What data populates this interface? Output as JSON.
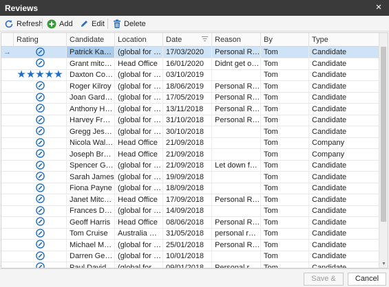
{
  "window": {
    "title": "Reviews",
    "close_glyph": "×"
  },
  "toolbar": {
    "refresh_label": "Refresh",
    "add_label": "Add",
    "edit_label": "Edit",
    "delete_label": "Delete"
  },
  "grid": {
    "columns": [
      "Rating",
      "Candidate",
      "Location",
      "Date",
      "Reason",
      "By",
      "Type"
    ],
    "rows": [
      {
        "rating": "icon",
        "candidate": "Patrick Kaufm...",
        "location": "(global for all l...",
        "date": "17/03/2020",
        "reason": "Personal Reas...",
        "by": "Tom",
        "type": "Candidate",
        "selected": true
      },
      {
        "rating": "icon",
        "candidate": "Grant mitchell",
        "location": "Head Office",
        "date": "16/01/2020",
        "reason": "Didnt get on...",
        "by": "Tom",
        "type": "Candidate"
      },
      {
        "rating": "stars",
        "stars": 5,
        "candidate": "Daxton Combs",
        "location": "(global for all l...",
        "date": "03/10/2019",
        "reason": "",
        "by": "Tom",
        "type": "Candidate"
      },
      {
        "rating": "icon",
        "candidate": "Roger Kilroy",
        "location": "(global for all l...",
        "date": "18/06/2019",
        "reason": "Personal Reas...",
        "by": "Tom",
        "type": "Candidate"
      },
      {
        "rating": "icon",
        "candidate": "Joan Gardner",
        "location": "(global for all l...",
        "date": "17/05/2019",
        "reason": "Personal Reas...",
        "by": "Tom",
        "type": "Candidate"
      },
      {
        "rating": "icon",
        "candidate": "Anthony Hutc...",
        "location": "(global for all l...",
        "date": "13/11/2018",
        "reason": "Personal Reas...",
        "by": "Tom",
        "type": "Candidate"
      },
      {
        "rating": "icon",
        "candidate": "Harvey Freem...",
        "location": "(global for all l...",
        "date": "31/10/2018",
        "reason": "Personal Reas...",
        "by": "Tom",
        "type": "Candidate"
      },
      {
        "rating": "icon",
        "candidate": "Gregg Jessop",
        "location": "(global for all l...",
        "date": "30/10/2018",
        "reason": "",
        "by": "Tom",
        "type": "Candidate"
      },
      {
        "rating": "icon",
        "candidate": "Nicola Walters",
        "location": "Head Office",
        "date": "21/09/2018",
        "reason": "",
        "by": "Tom",
        "type": "Company"
      },
      {
        "rating": "icon",
        "candidate": "Joseph Brown",
        "location": "Head Office",
        "date": "21/09/2018",
        "reason": "",
        "by": "Tom",
        "type": "Company"
      },
      {
        "rating": "icon",
        "candidate": "Spencer Grey",
        "location": "(global for all l...",
        "date": "21/09/2018",
        "reason": "Let down for...",
        "by": "Tom",
        "type": "Candidate"
      },
      {
        "rating": "icon",
        "candidate": "Sarah James",
        "location": "(global for all l...",
        "date": "19/09/2018",
        "reason": "",
        "by": "Tom",
        "type": "Candidate"
      },
      {
        "rating": "icon",
        "candidate": "Fiona Payne",
        "location": "(global for all l...",
        "date": "18/09/2018",
        "reason": "",
        "by": "Tom",
        "type": "Candidate"
      },
      {
        "rating": "icon",
        "candidate": "Janet Mitchell",
        "location": "Head Office",
        "date": "17/09/2018",
        "reason": "Personal Reas...",
        "by": "Tom",
        "type": "Candidate"
      },
      {
        "rating": "icon",
        "candidate": "Frances Drake",
        "location": "(global for all l...",
        "date": "14/09/2018",
        "reason": "",
        "by": "Tom",
        "type": "Candidate"
      },
      {
        "rating": "icon",
        "candidate": "Geoff Harris",
        "location": "Head Office",
        "date": "08/06/2018",
        "reason": "Personal Reas...",
        "by": "Tom",
        "type": "Candidate"
      },
      {
        "rating": "icon",
        "candidate": "Tom Cruise",
        "location": "Australia Office",
        "date": "31/05/2018",
        "reason": "personal reas...",
        "by": "Tom",
        "type": "Candidate"
      },
      {
        "rating": "icon",
        "candidate": "Michael Martins",
        "location": "(global for all l...",
        "date": "25/01/2018",
        "reason": "Personal Reas...",
        "by": "Tom",
        "type": "Candidate"
      },
      {
        "rating": "icon",
        "candidate": "Darren George",
        "location": "(global for all l...",
        "date": "10/01/2018",
        "reason": "",
        "by": "Tom",
        "type": "Candidate"
      },
      {
        "rating": "icon",
        "candidate": "Paul Davidson",
        "location": "(global for all l...",
        "date": "09/01/2018",
        "reason": "Personal reas...",
        "by": "Tom",
        "type": "Candidate"
      }
    ]
  },
  "footer": {
    "save_close_label": "Save & Close",
    "cancel_label": "Cancel"
  },
  "colors": {
    "accent": "#1e6fc4",
    "selected_row": "#cfe3f7",
    "titlebar": "#3a3a3a"
  },
  "icons": {
    "rating_icon": "pencil-circle-icon",
    "row_indicator": "→"
  }
}
